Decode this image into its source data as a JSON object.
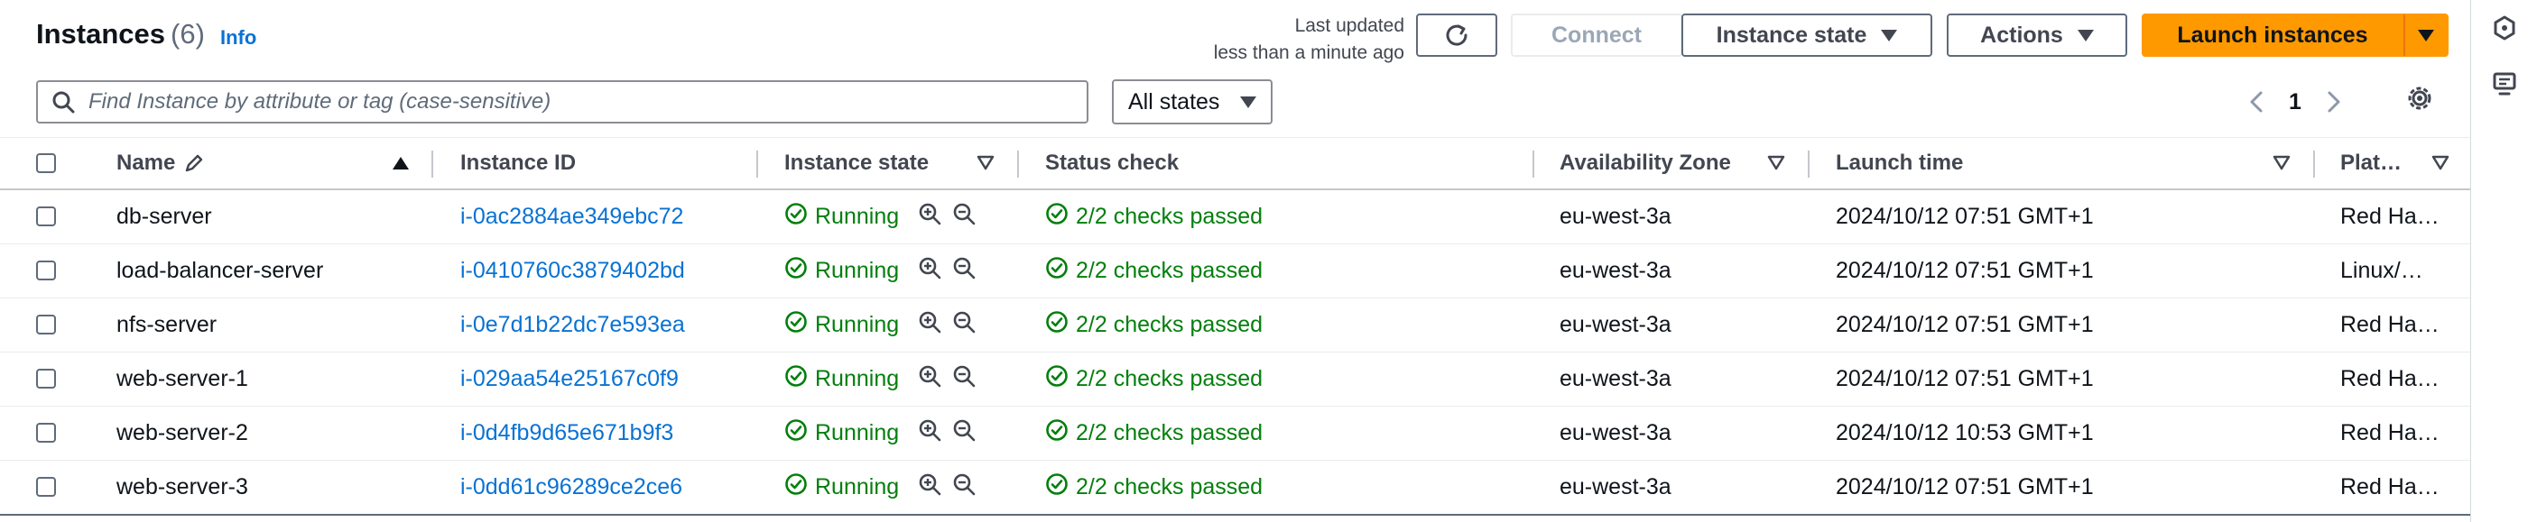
{
  "header": {
    "title": "Instances",
    "count": "(6)",
    "info_label": "Info",
    "last_updated_line1": "Last updated",
    "last_updated_line2": "less than a minute ago"
  },
  "toolbar": {
    "connect_label": "Connect",
    "instance_state_label": "Instance state",
    "actions_label": "Actions",
    "launch_label": "Launch instances"
  },
  "search": {
    "placeholder": "Find Instance by attribute or tag (case-sensitive)"
  },
  "filter": {
    "selected": "All states"
  },
  "pagination": {
    "current_page": "1"
  },
  "table": {
    "columns": {
      "name": "Name",
      "instance_id": "Instance ID",
      "instance_state": "Instance state",
      "status_check": "Status check",
      "availability_zone": "Availability Zone",
      "launch_time": "Launch time",
      "platform": "Plat…"
    },
    "rows": [
      {
        "name": "db-server",
        "instance_id": "i-0ac2884ae349ebc72",
        "state": "Running",
        "status": "2/2 checks passed",
        "zone": "eu-west-3a",
        "launch": "2024/10/12 07:51 GMT+1",
        "platform": "Red Ha…"
      },
      {
        "name": "load-balancer-server",
        "instance_id": "i-0410760c3879402bd",
        "state": "Running",
        "status": "2/2 checks passed",
        "zone": "eu-west-3a",
        "launch": "2024/10/12 07:51 GMT+1",
        "platform": "Linux/…"
      },
      {
        "name": "nfs-server",
        "instance_id": "i-0e7d1b22dc7e593ea",
        "state": "Running",
        "status": "2/2 checks passed",
        "zone": "eu-west-3a",
        "launch": "2024/10/12 07:51 GMT+1",
        "platform": "Red Ha…"
      },
      {
        "name": "web-server-1",
        "instance_id": "i-029aa54e25167c0f9",
        "state": "Running",
        "status": "2/2 checks passed",
        "zone": "eu-west-3a",
        "launch": "2024/10/12 07:51 GMT+1",
        "platform": "Red Ha…"
      },
      {
        "name": "web-server-2",
        "instance_id": "i-0d4fb9d65e671b9f3",
        "state": "Running",
        "status": "2/2 checks passed",
        "zone": "eu-west-3a",
        "launch": "2024/10/12 10:53 GMT+1",
        "platform": "Red Ha…"
      },
      {
        "name": "web-server-3",
        "instance_id": "i-0dd61c96289ce2ce6",
        "state": "Running",
        "status": "2/2 checks passed",
        "zone": "eu-west-3a",
        "launch": "2024/10/12 07:51 GMT+1",
        "platform": "Red Ha…"
      }
    ]
  },
  "colors": {
    "primary": "#ff9900",
    "link": "#0972d3",
    "success": "#037f0c",
    "text": "#0f141a"
  }
}
